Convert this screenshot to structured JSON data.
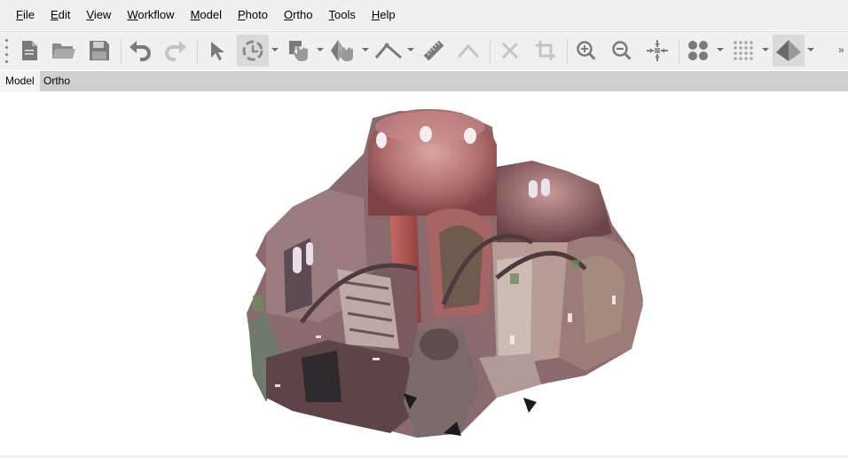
{
  "menu": {
    "items": [
      {
        "mnemonic": "F",
        "rest": "ile"
      },
      {
        "mnemonic": "E",
        "rest": "dit"
      },
      {
        "mnemonic": "V",
        "rest": "iew"
      },
      {
        "mnemonic": "W",
        "rest": "orkflow"
      },
      {
        "mnemonic": "M",
        "rest": "odel"
      },
      {
        "mnemonic": "P",
        "rest": "hoto"
      },
      {
        "mnemonic": "O",
        "rest": "rtho"
      },
      {
        "mnemonic": "T",
        "rest": "ools"
      },
      {
        "mnemonic": "H",
        "rest": "elp"
      }
    ]
  },
  "toolbar": {
    "icons": [
      "new-file-icon",
      "open-folder-icon",
      "save-icon",
      "undo-icon",
      "redo-icon",
      "navigation-cursor-icon",
      "rotate-object-icon",
      "rectangle-selection-icon",
      "region-transform-icon",
      "draw-polyline-icon",
      "ruler-icon",
      "draw-polygon-icon",
      "delete-selection-icon",
      "crop-selection-icon",
      "zoom-in-icon",
      "zoom-out-icon",
      "reset-view-icon",
      "point-cloud-icon",
      "dense-cloud-icon",
      "model-shaded-icon"
    ],
    "active": [
      "rotate-object-icon",
      "model-shaded-icon"
    ],
    "overflow_label": "»"
  },
  "tabs": [
    {
      "label": "Model",
      "active": true
    },
    {
      "label": "Ortho",
      "active": false
    }
  ],
  "viewport": {
    "content": "3d-model-render"
  },
  "colors": {
    "chrome": "#f0f0f0",
    "tabbar": "#cfcfcf",
    "icon_gray": "#7a7a7a",
    "icon_disabled": "#c4c4c4"
  }
}
